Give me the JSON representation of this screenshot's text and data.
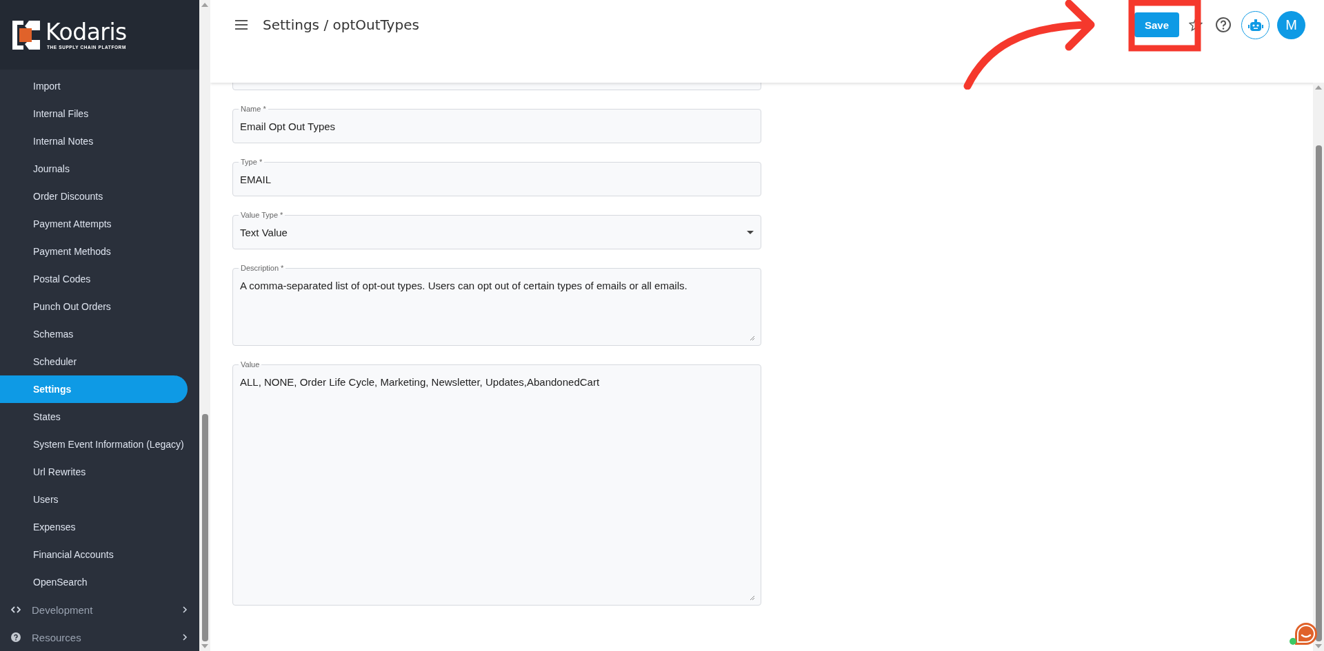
{
  "sidebar": {
    "logo": {
      "name": "Kodaris",
      "tagline": "THE SUPPLY CHAIN PLATFORM"
    },
    "items": [
      {
        "label": "Import",
        "selected": false
      },
      {
        "label": "Internal Files",
        "selected": false
      },
      {
        "label": "Internal Notes",
        "selected": false
      },
      {
        "label": "Journals",
        "selected": false
      },
      {
        "label": "Order Discounts",
        "selected": false
      },
      {
        "label": "Payment Attempts",
        "selected": false
      },
      {
        "label": "Payment Methods",
        "selected": false
      },
      {
        "label": "Postal Codes",
        "selected": false
      },
      {
        "label": "Punch Out Orders",
        "selected": false
      },
      {
        "label": "Schemas",
        "selected": false
      },
      {
        "label": "Scheduler",
        "selected": false
      },
      {
        "label": "Settings",
        "selected": true
      },
      {
        "label": "States",
        "selected": false
      },
      {
        "label": "System Event Information (Legacy)",
        "selected": false
      },
      {
        "label": "Url Rewrites",
        "selected": false
      },
      {
        "label": "Users",
        "selected": false
      },
      {
        "label": "Expenses",
        "selected": false
      },
      {
        "label": "Financial Accounts",
        "selected": false
      },
      {
        "label": "OpenSearch",
        "selected": false
      }
    ],
    "sections": [
      {
        "label": "Development",
        "kind": "code"
      },
      {
        "label": "Resources",
        "kind": "help"
      }
    ]
  },
  "header": {
    "title": "Settings / optOutTypes",
    "save_button": "Save",
    "avatar": "M"
  },
  "form": {
    "fields": [
      {
        "kind": "text"
      },
      {
        "kind": "text",
        "label": "Name *",
        "value": "Email Opt Out Types"
      },
      {
        "kind": "text",
        "label": "Type *",
        "value": "EMAIL"
      },
      {
        "kind": "select",
        "label": "Value Type *",
        "value": "Text Value"
      },
      {
        "kind": "textarea",
        "label": "Description *",
        "value": "A comma-separated list of opt-out types.  Users can opt out of certain types of emails or all emails."
      },
      {
        "kind": "bigtextarea",
        "label": "Value",
        "value": "ALL, NONE, Order Life Cycle,  Marketing, Newsletter, Updates,AbandonedCart"
      }
    ]
  }
}
